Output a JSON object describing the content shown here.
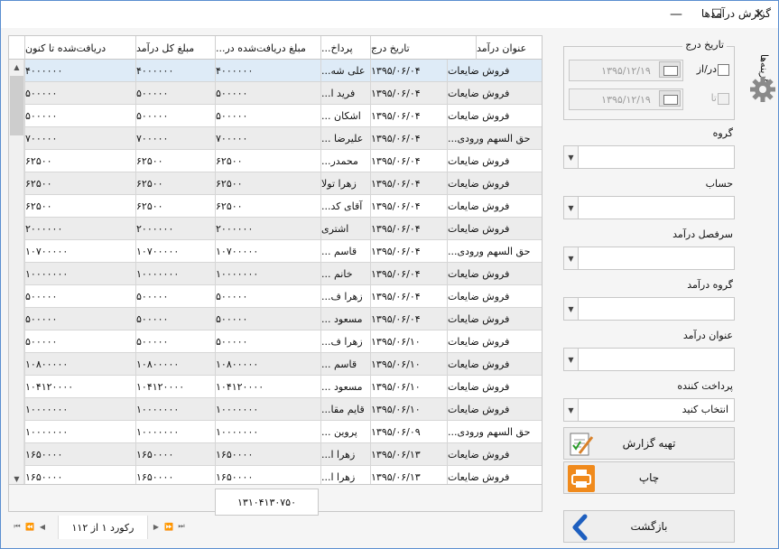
{
  "window": {
    "title": "گزارش درآمدها"
  },
  "grid": {
    "columns": [
      "عنوان درآمد",
      "تاریخ درج",
      "پرداخ...",
      "مبلغ دریافت‌شده در...",
      "مبلغ کل درآمد",
      "دریافت‌شده تا کنون"
    ],
    "rows": [
      [
        "فروش ضایعات",
        "۱۳۹۵/۰۶/۰۴",
        "علی شه...",
        "۴۰۰۰۰۰۰",
        "۴۰۰۰۰۰۰",
        "۴۰۰۰۰۰۰"
      ],
      [
        "فروش ضایعات",
        "۱۳۹۵/۰۶/۰۴",
        "فرید ا...",
        "۵۰۰۰۰۰",
        "۵۰۰۰۰۰",
        "۵۰۰۰۰۰"
      ],
      [
        "فروش ضایعات",
        "۱۳۹۵/۰۶/۰۴",
        "اشکان ...",
        "۵۰۰۰۰۰",
        "۵۰۰۰۰۰",
        "۵۰۰۰۰۰"
      ],
      [
        "حق السهم ورودی...",
        "۱۳۹۵/۰۶/۰۴",
        "علیرضا ...",
        "۷۰۰۰۰۰",
        "۷۰۰۰۰۰",
        "۷۰۰۰۰۰"
      ],
      [
        "فروش ضایعات",
        "۱۳۹۵/۰۶/۰۴",
        "محمدر...",
        "۶۲۵۰۰",
        "۶۲۵۰۰",
        "۶۲۵۰۰"
      ],
      [
        "فروش ضایعات",
        "۱۳۹۵/۰۶/۰۴",
        "زهرا تولا",
        "۶۲۵۰۰",
        "۶۲۵۰۰",
        "۶۲۵۰۰"
      ],
      [
        "فروش ضایعات",
        "۱۳۹۵/۰۶/۰۴",
        "آقای کد...",
        "۶۲۵۰۰",
        "۶۲۵۰۰",
        "۶۲۵۰۰"
      ],
      [
        "فروش ضایعات",
        "۱۳۹۵/۰۶/۰۴",
        "اشتری",
        "۲۰۰۰۰۰۰",
        "۲۰۰۰۰۰۰",
        "۲۰۰۰۰۰۰"
      ],
      [
        "حق السهم ورودی...",
        "۱۳۹۵/۰۶/۰۴",
        "قاسم ...",
        "۱۰۷۰۰۰۰۰",
        "۱۰۷۰۰۰۰۰",
        "۱۰۷۰۰۰۰۰"
      ],
      [
        "فروش ضایعات",
        "۱۳۹۵/۰۶/۰۴",
        "خانم ...",
        "۱۰۰۰۰۰۰۰",
        "۱۰۰۰۰۰۰۰",
        "۱۰۰۰۰۰۰۰"
      ],
      [
        "فروش ضایعات",
        "۱۳۹۵/۰۶/۰۴",
        "زهرا ف...",
        "۵۰۰۰۰۰",
        "۵۰۰۰۰۰",
        "۵۰۰۰۰۰"
      ],
      [
        "فروش ضایعات",
        "۱۳۹۵/۰۶/۰۴",
        "مسعود ...",
        "۵۰۰۰۰۰",
        "۵۰۰۰۰۰",
        "۵۰۰۰۰۰"
      ],
      [
        "فروش ضایعات",
        "۱۳۹۵/۰۶/۱۰",
        "زهرا ف...",
        "۵۰۰۰۰۰",
        "۵۰۰۰۰۰",
        "۵۰۰۰۰۰"
      ],
      [
        "فروش ضایعات",
        "۱۳۹۵/۰۶/۱۰",
        "قاسم ...",
        "۱۰۸۰۰۰۰۰",
        "۱۰۸۰۰۰۰۰",
        "۱۰۸۰۰۰۰۰"
      ],
      [
        "فروش ضایعات",
        "۱۳۹۵/۰۶/۱۰",
        "مسعود ...",
        "۱۰۴۱۲۰۰۰۰",
        "۱۰۴۱۲۰۰۰۰",
        "۱۰۴۱۲۰۰۰۰"
      ],
      [
        "فروش ضایعات",
        "۱۳۹۵/۰۶/۱۰",
        "قایم مقا...",
        "۱۰۰۰۰۰۰۰",
        "۱۰۰۰۰۰۰۰",
        "۱۰۰۰۰۰۰۰"
      ],
      [
        "حق السهم ورودی...",
        "۱۳۹۵/۰۶/۰۹",
        "پروین ...",
        "۱۰۰۰۰۰۰۰",
        "۱۰۰۰۰۰۰۰",
        "۱۰۰۰۰۰۰۰"
      ],
      [
        "فروش ضایعات",
        "۱۳۹۵/۰۶/۱۳",
        "زهرا ا...",
        "۱۶۵۰۰۰۰",
        "۱۶۵۰۰۰۰",
        "۱۶۵۰۰۰۰"
      ],
      [
        "فروش ضایعات",
        "۱۳۹۵/۰۶/۱۳",
        "زهرا ا...",
        "۱۶۵۰۰۰۰",
        "۱۶۵۰۰۰۰",
        "۱۶۵۰۰۰۰"
      ]
    ],
    "total": "۱۳۱۰۴۱۳۰۷۵۰"
  },
  "navigator": {
    "record_text": "رکورد ۱ از ۱۱۲"
  },
  "filters": {
    "date_group_title": "تاریخ درج",
    "from_label": "در/از",
    "from_value": "۱۳۹۵/۱۲/۱۹",
    "to_label": "تا",
    "to_value": "۱۳۹۵/۱۲/۱۹",
    "group_label": "گروه",
    "account_label": "حساب",
    "income_heading_label": "سرفصل درآمد",
    "income_group_label": "گروه درآمد",
    "income_title_label": "عنوان درآمد",
    "payer_label": "پرداخت کننده",
    "payer_value": "انتخاب کنید"
  },
  "buttons": {
    "prepare_report": "تهیه گزارش",
    "print": "چاپ",
    "back": "بازگشت"
  },
  "side_tab": {
    "label": "گزینه‌ها"
  }
}
